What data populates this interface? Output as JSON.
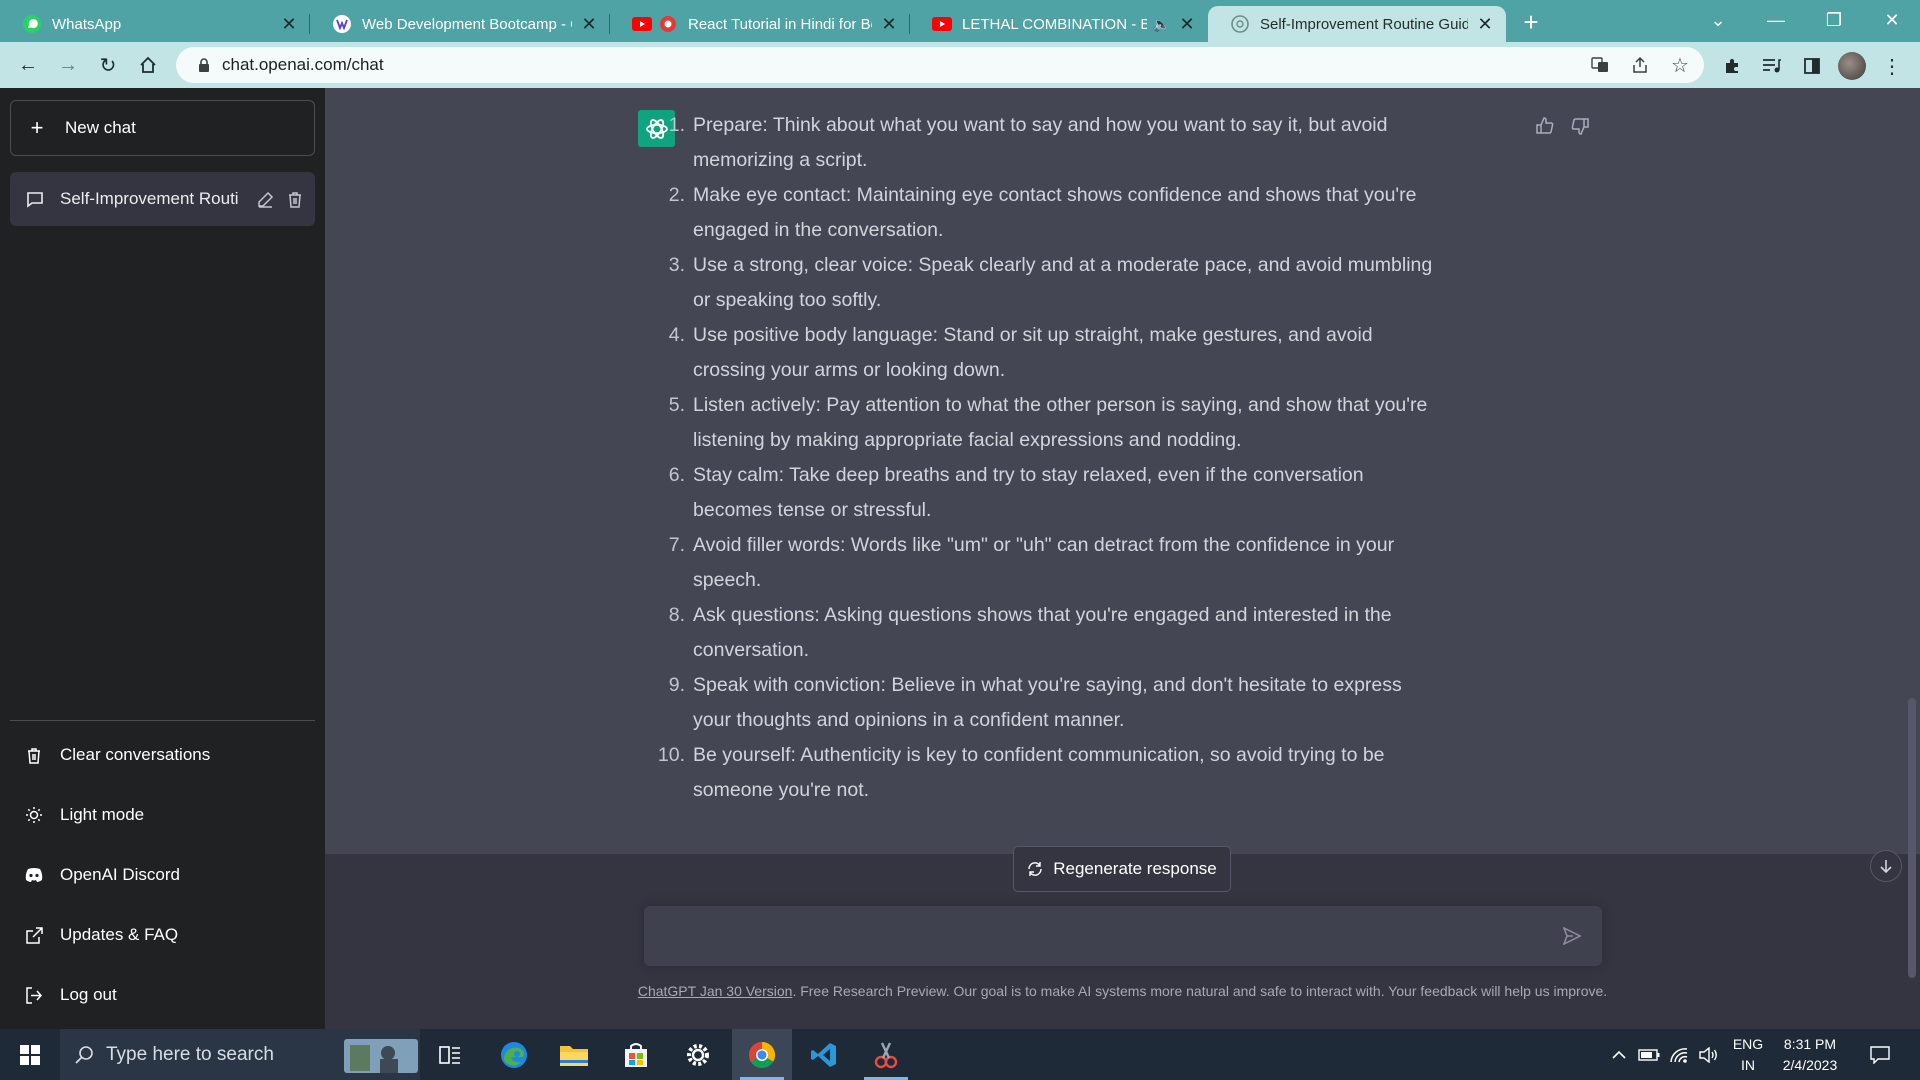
{
  "browser": {
    "tabs": [
      {
        "title": "WhatsApp",
        "icon": "whatsapp-icon"
      },
      {
        "title": "Web Development Bootcamp - C",
        "icon": "bootcamp-icon"
      },
      {
        "title": "React Tutorial in Hindi for Be",
        "icon": "youtube-icon"
      },
      {
        "title": "LETHAL COMBINATION - BIL",
        "icon": "youtube-icon"
      },
      {
        "title": "Self-Improvement Routine Guide",
        "icon": "chatgpt-icon"
      }
    ],
    "url": "chat.openai.com/chat"
  },
  "sidebar": {
    "new_chat": "New chat",
    "conversation": "Self-Improvement Routi",
    "bottom_items": [
      {
        "label": "Clear conversations",
        "icon": "trash-icon"
      },
      {
        "label": "Light mode",
        "icon": "sun-icon"
      },
      {
        "label": "OpenAI Discord",
        "icon": "discord-icon"
      },
      {
        "label": "Updates & FAQ",
        "icon": "external-link-icon"
      },
      {
        "label": "Log out",
        "icon": "logout-icon"
      }
    ]
  },
  "answer": {
    "items": [
      {
        "num": "1.",
        "text": "Prepare: Think about what you want to say and how you want to say it, but avoid memorizing a script."
      },
      {
        "num": "2.",
        "text": "Make eye contact: Maintaining eye contact shows confidence and shows that you're engaged in the conversation."
      },
      {
        "num": "3.",
        "text": "Use a strong, clear voice: Speak clearly and at a moderate pace, and avoid mumbling or speaking too softly."
      },
      {
        "num": "4.",
        "text": "Use positive body language: Stand or sit up straight, make gestures, and avoid crossing your arms or looking down."
      },
      {
        "num": "5.",
        "text": "Listen actively: Pay attention to what the other person is saying, and show that you're listening by making appropriate facial expressions and nodding."
      },
      {
        "num": "6.",
        "text": "Stay calm: Take deep breaths and try to stay relaxed, even if the conversation becomes tense or stressful."
      },
      {
        "num": "7.",
        "text": "Avoid filler words: Words like \"um\" or \"uh\" can detract from the confidence in your speech."
      },
      {
        "num": "8.",
        "text": "Ask questions: Asking questions shows that you're engaged and interested in the conversation."
      },
      {
        "num": "9.",
        "text": "Speak with conviction: Believe in what you're saying, and don't hesitate to express your thoughts and opinions in a confident manner."
      },
      {
        "num": "10.",
        "text": "Be yourself: Authenticity is key to confident communication, so avoid trying to be someone you're not."
      }
    ]
  },
  "composer": {
    "regenerate": "Regenerate response",
    "input_value": ""
  },
  "footer": {
    "version_link": "ChatGPT Jan 30 Version",
    "text": ". Free Research Preview. Our goal is to make AI systems more natural and safe to interact with. Your feedback will help us improve."
  },
  "taskbar": {
    "search_placeholder": "Type here to search",
    "lang_1": "ENG",
    "lang_2": "IN",
    "time": "8:31 PM",
    "date": "2/4/2023"
  },
  "colors": {
    "tab_strip": "#4fa3a5",
    "toolbar": "#c3e4e4",
    "sidebar": "#202123",
    "message_bg": "#444654",
    "chat_bg": "#343541",
    "accent": "#10a37f"
  }
}
